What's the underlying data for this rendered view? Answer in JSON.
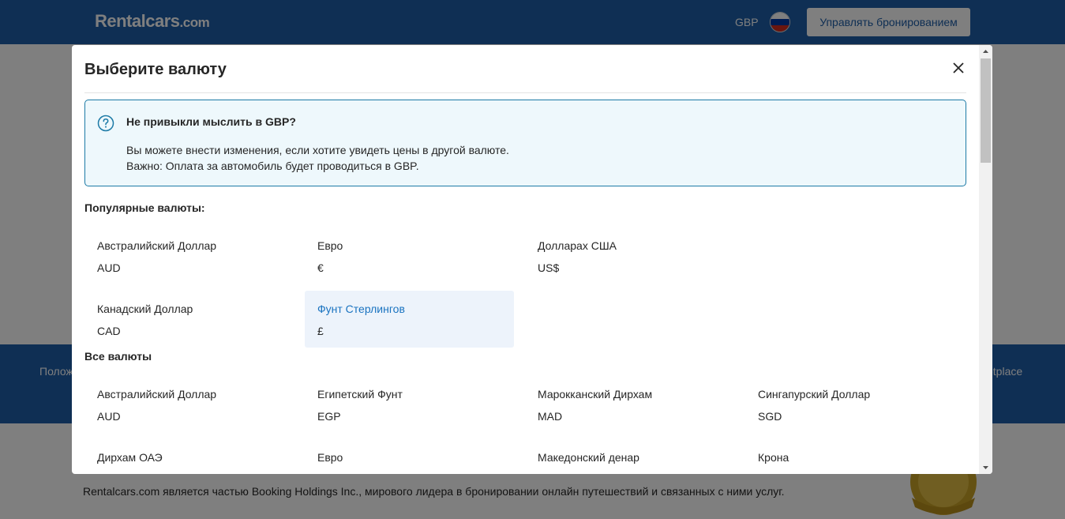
{
  "header": {
    "logo_main": "Rentalcars",
    "logo_suffix": ".com",
    "currency": "GBP",
    "manage_booking": "Управлять бронированием"
  },
  "footer": {
    "left_partial": "Полож",
    "right_partial": "etplace",
    "legal": "Rentalcars.com является частью Booking Holdings Inc., мирового лидера в бронировании онлайн путешествий и связанных с ними услуг."
  },
  "modal": {
    "title": "Выберите валюту",
    "info": {
      "title": "Не привыкли мыслить в GBP?",
      "line1": "Вы можете внести изменения, если хотите увидеть цены в другой валюте.",
      "line2": "Важно: Оплата за автомобиль будет проводиться в GBP."
    },
    "popular_title": "Популярные валюты:",
    "popular": [
      {
        "name": "Австралийский Доллар",
        "code": "AUD"
      },
      {
        "name": "Евро",
        "code": "€"
      },
      {
        "name": "Долларах США",
        "code": "US$"
      },
      {
        "name": "Канадский Доллар",
        "code": "CAD"
      },
      {
        "name": "Фунт Стерлингов",
        "code": "£",
        "selected": true
      }
    ],
    "all_title": "Все валюты",
    "all": [
      {
        "name": "Австралийский Доллар",
        "code": "AUD"
      },
      {
        "name": "Египетский Фунт",
        "code": "EGP"
      },
      {
        "name": "Марокканский Дирхам",
        "code": "MAD"
      },
      {
        "name": "Сингапурский Доллар",
        "code": "SGD"
      },
      {
        "name": "Дирхам ОАЭ",
        "code": ""
      },
      {
        "name": "Евро",
        "code": ""
      },
      {
        "name": "Македонский денар",
        "code": ""
      },
      {
        "name": "Крона",
        "code": ""
      }
    ]
  },
  "colors": {
    "brand_blue": "#1e5ea8",
    "selected_text": "#1a73c0",
    "info_border": "#1c7aa6"
  }
}
